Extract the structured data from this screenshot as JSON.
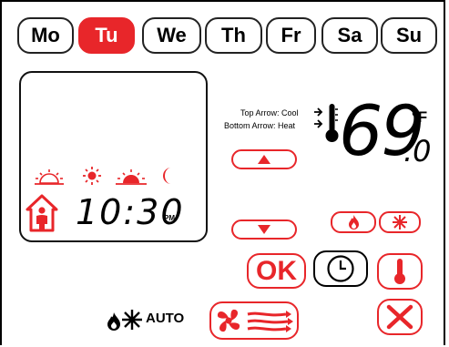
{
  "days": [
    {
      "label": "Mo",
      "selected": false
    },
    {
      "label": "Tu",
      "selected": true
    },
    {
      "label": "We",
      "selected": false
    },
    {
      "label": "Th",
      "selected": false
    },
    {
      "label": "Fr",
      "selected": false
    },
    {
      "label": "Sa",
      "selected": false
    },
    {
      "label": "Su",
      "selected": false
    }
  ],
  "display": {
    "time": "10:30",
    "ampm": "PM",
    "schedule_icons": [
      "sunrise-icon",
      "sun-icon",
      "sunset-icon",
      "moon-icon"
    ],
    "occupancy_icon": "person-in-house-icon"
  },
  "temperature": {
    "value": "69",
    "decimal": ".0",
    "unit": "°F",
    "legend_top": "Top Arrow: Cool",
    "legend_bottom": "Bottom Arrow: Heat"
  },
  "controls": {
    "ok_label": "OK",
    "mode_auto": "AUTO",
    "up_arrow": "up-arrow-icon",
    "down_arrow": "down-arrow-icon"
  },
  "colors": {
    "accent": "#e8262a",
    "ink": "#000000"
  }
}
